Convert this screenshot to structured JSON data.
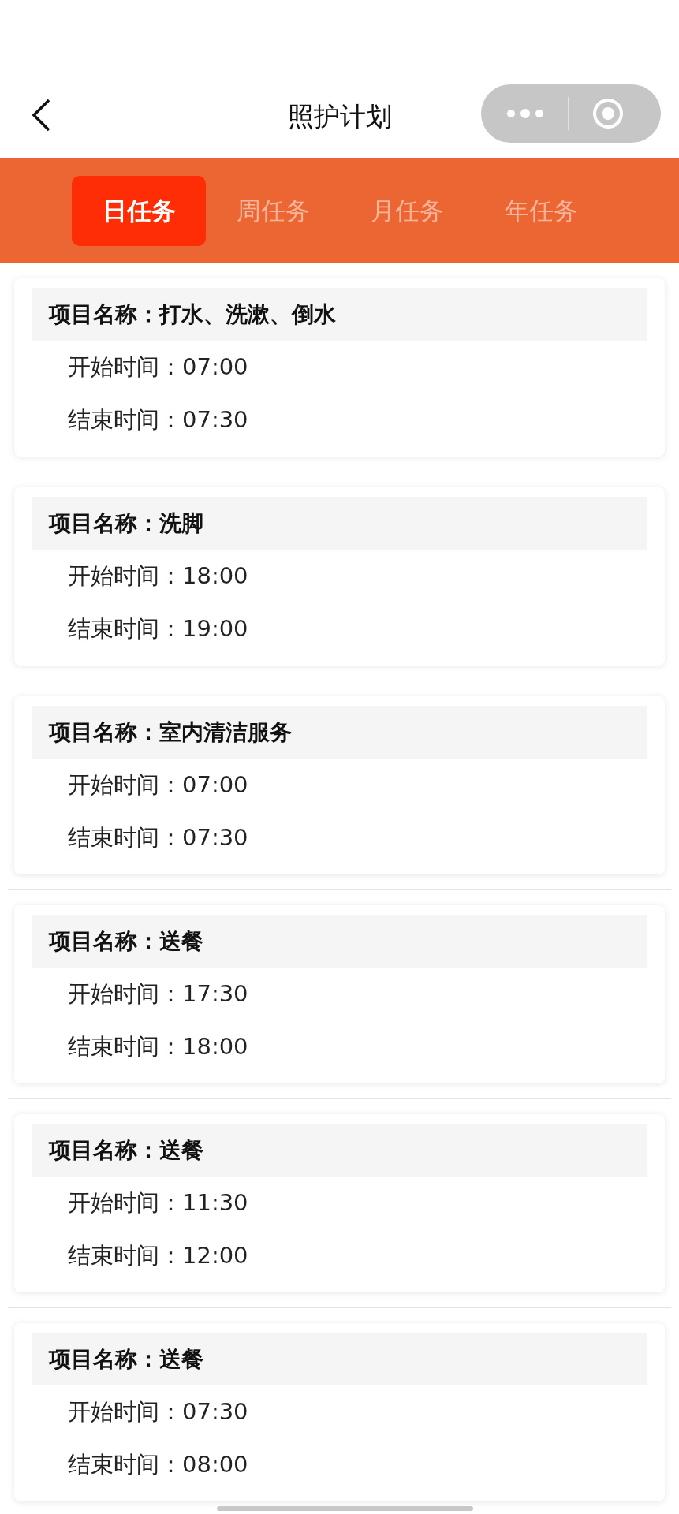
{
  "nav": {
    "title": "照护计划"
  },
  "tabs": [
    {
      "label": "日任务",
      "selected": true
    },
    {
      "label": "周任务",
      "selected": false
    },
    {
      "label": "月任务",
      "selected": false
    },
    {
      "label": "年任务",
      "selected": false
    }
  ],
  "tasks": [
    {
      "name": "项目名称：打水、洗漱、倒水",
      "start": "开始时间：07:00",
      "end": "结束时间：07:30"
    },
    {
      "name": "项目名称：洗脚",
      "start": "开始时间：18:00",
      "end": "结束时间：19:00"
    },
    {
      "name": "项目名称：室内清洁服务",
      "start": "开始时间：07:00",
      "end": "结束时间：07:30"
    },
    {
      "name": "项目名称：送餐",
      "start": "开始时间：17:30",
      "end": "结束时间：18:00"
    },
    {
      "name": "项目名称：送餐",
      "start": "开始时间：11:30",
      "end": "结束时间：12:00"
    },
    {
      "name": "项目名称：送餐",
      "start": "开始时间：07:30",
      "end": "结束时间：08:00"
    }
  ]
}
